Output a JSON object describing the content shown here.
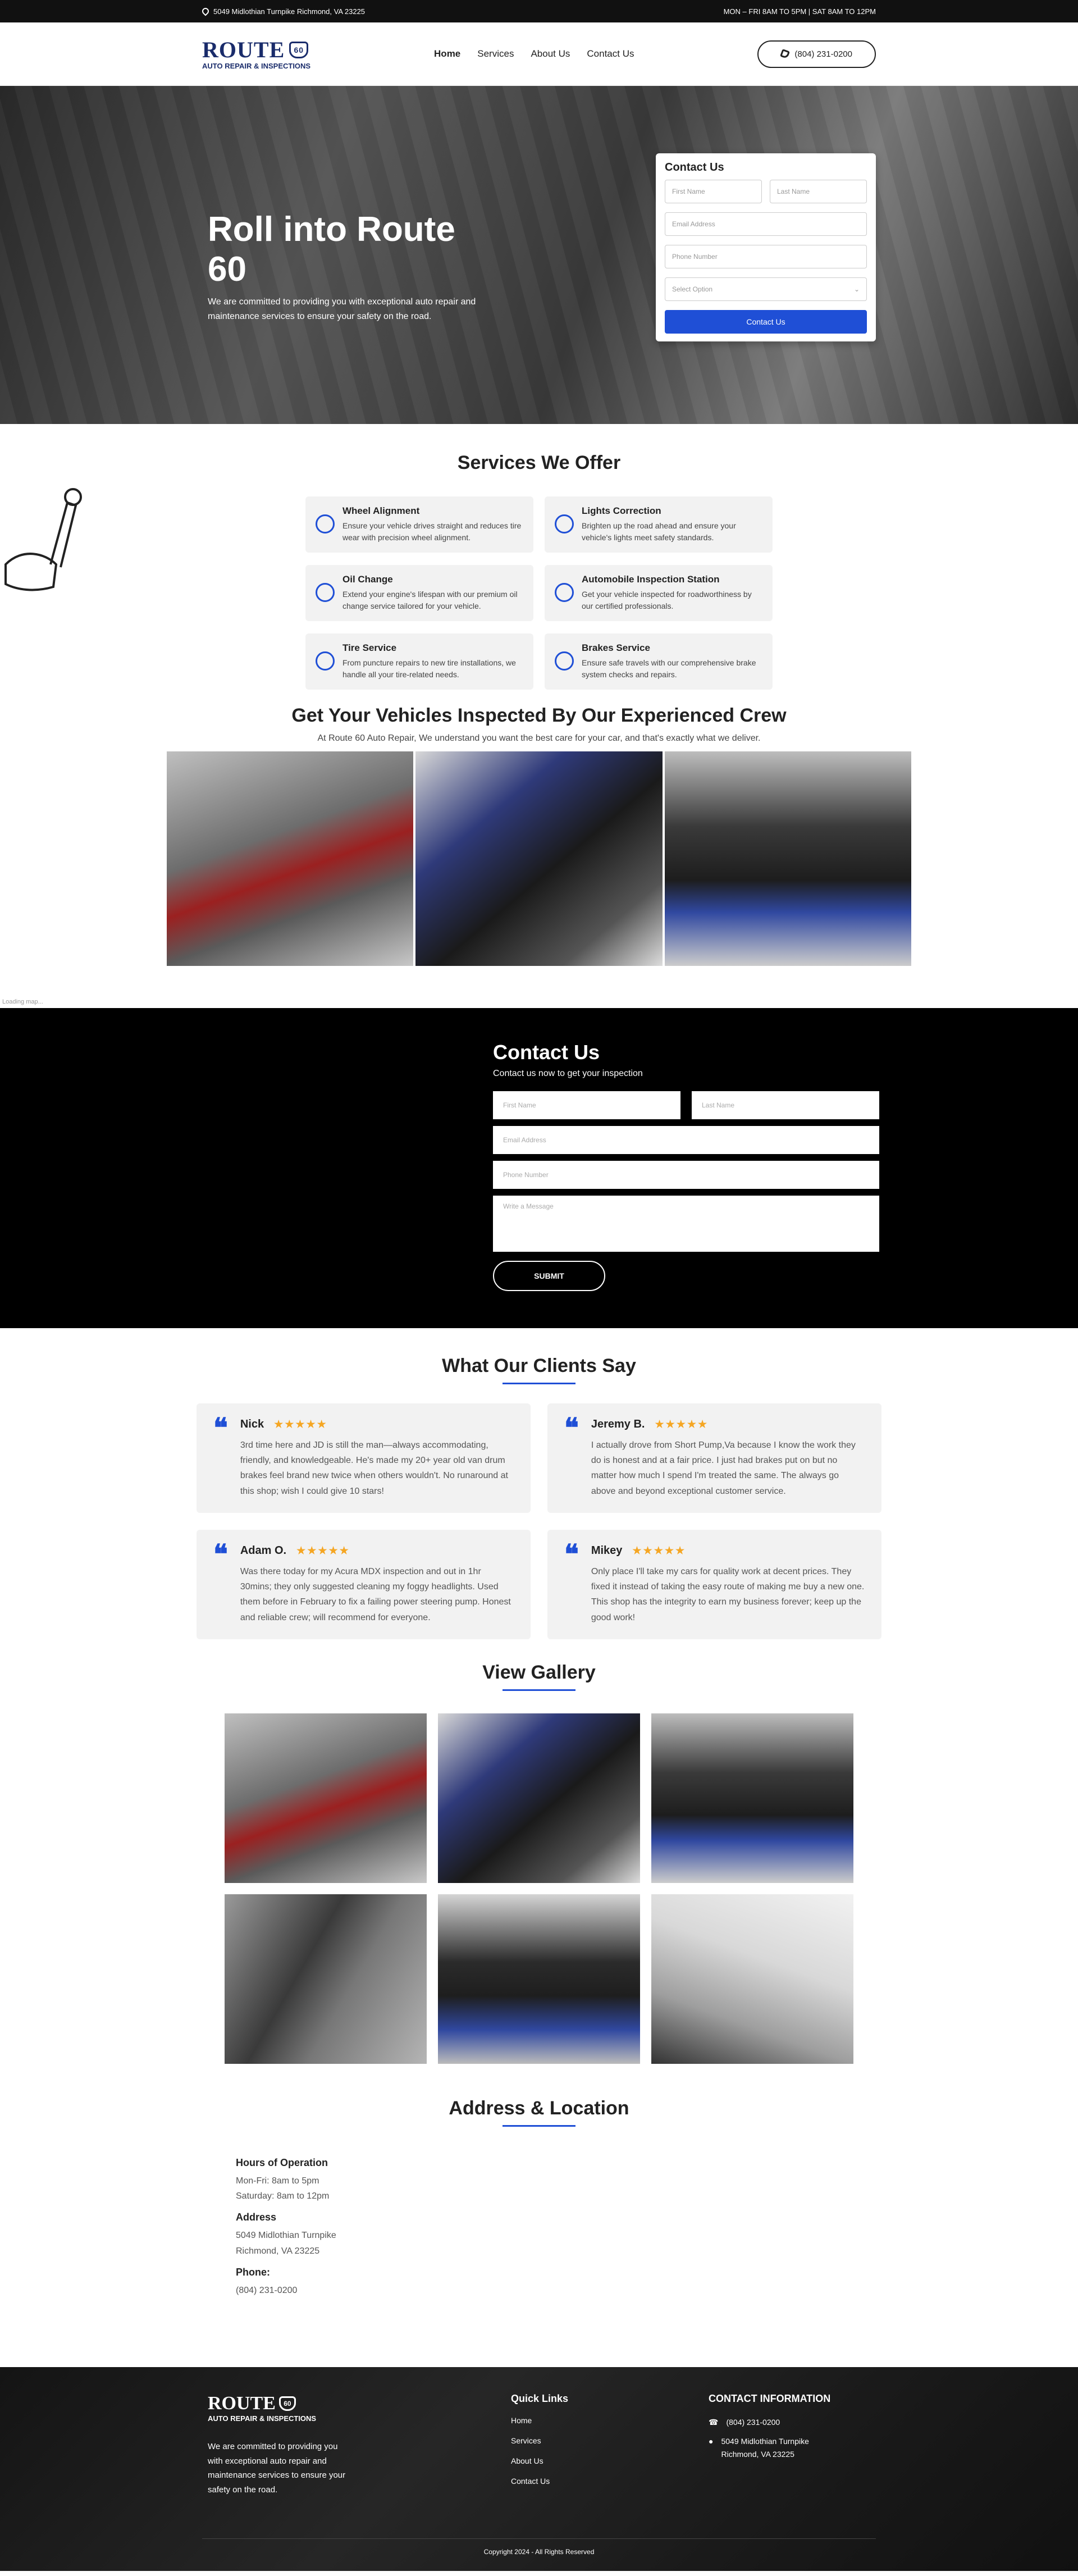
{
  "topbar": {
    "address": "5049 Midlothian Turnpike Richmond, VA 23225",
    "hours": "MON – FRI 8AM TO 5PM | SAT 8AM TO 12PM"
  },
  "logo": {
    "line1": "ROUTE",
    "badge": "60",
    "line2": "AUTO REPAIR & INSPECTIONS"
  },
  "nav": {
    "home": "Home",
    "services": "Services",
    "about": "About Us",
    "contact": "Contact Us"
  },
  "header": {
    "phone": "(804) 231-0200"
  },
  "hero": {
    "title": "Roll into Route 60",
    "text": "We are committed to providing you with exceptional auto repair and maintenance services to ensure your safety on the road."
  },
  "hero_form": {
    "title": "Contact Us",
    "first": "First Name",
    "last": "Last Name",
    "email": "Email Address",
    "phone": "Phone Number",
    "select": "Select Option",
    "submit": "Contact Us"
  },
  "services": {
    "title": "Services We Offer",
    "items": [
      {
        "title": "Wheel Alignment",
        "text": "Ensure your vehicle drives straight and reduces tire wear with precision wheel alignment."
      },
      {
        "title": "Lights Correction",
        "text": "Brighten up the road ahead and ensure your vehicle's lights meet safety standards."
      },
      {
        "title": "Oil Change",
        "text": "Extend your engine's lifespan with our premium oil change service tailored for your vehicle."
      },
      {
        "title": "Automobile Inspection Station",
        "text": "Get your vehicle inspected for roadworthiness by our certified professionals."
      },
      {
        "title": "Tire Service",
        "text": "From puncture repairs to new tire installations, we handle all your tire-related needs."
      },
      {
        "title": "Brakes Service",
        "text": "Ensure safe travels with our comprehensive brake system checks and repairs."
      }
    ]
  },
  "inspect": {
    "title": "Get Your Vehicles Inspected By Our Experienced Crew",
    "text": "At Route 60 Auto Repair, We understand you want the best care for your car, and that's exactly what we deliver."
  },
  "loading": "Loading map...",
  "contact": {
    "title": "Contact Us",
    "sub": "Contact us now to get your inspection",
    "first": "First Name",
    "last": "Last Name",
    "email": "Email Address",
    "phone": "Phone Number",
    "message": "Write a Message",
    "submit": "SUBMIT"
  },
  "testimonials": {
    "title": "What Our Clients Say",
    "stars": "★★★★★",
    "items": [
      {
        "name": "Nick",
        "rating": 5,
        "text": "3rd time here and JD is still the man—always accommodating, friendly, and knowledgeable. He's made my 20+ year old van drum brakes feel brand new twice when others wouldn't. No runaround at this shop; wish I could give 10 stars!"
      },
      {
        "name": "Jeremy B.",
        "rating": 5,
        "text": "I actually drove from Short Pump,Va because I know the work they do is honest and at a fair price. I just had brakes put on but no matter how much I spend I'm treated the same. The always go above and beyond exceptional customer service."
      },
      {
        "name": "Adam O.",
        "rating": 5,
        "text": "Was there today for my Acura MDX inspection and out in 1hr 30mins; they only suggested cleaning my foggy headlights. Used them before in February to fix a failing power steering pump. Honest and reliable crew; will recommend for everyone."
      },
      {
        "name": "Mikey",
        "rating": 5,
        "text": "Only place I'll take my cars for quality work at decent prices. They fixed it instead of taking the easy route of making me buy a new one. This shop has the integrity to earn my business forever; keep up the good work!"
      }
    ]
  },
  "gallery": {
    "title": "View Gallery"
  },
  "address": {
    "title": "Address & Location",
    "hours_h": "Hours of Operation",
    "hours1": "Mon-Fri: 8am to 5pm",
    "hours2": "Saturday: 8am to 12pm",
    "addr_h": "Address",
    "addr1": "5049 Midlothian Turnpike",
    "addr2": "Richmond, VA 23225",
    "phone_h": "Phone:",
    "phone": "(804) 231-0200"
  },
  "footer": {
    "text": "We are committed to providing you with exceptional auto repair and maintenance services to ensure your safety on the road.",
    "links_h": "Quick Links",
    "links": [
      "Home",
      "Services",
      "About Us",
      "Contact Us"
    ],
    "contact_h": "CONTACT INFORMATION",
    "phone": "(804) 231-0200",
    "addr1": "5049 Midlothian Turnpike",
    "addr2": "Richmond, VA 23225",
    "copy": "Copyright 2024 - All Rights Reserved"
  }
}
